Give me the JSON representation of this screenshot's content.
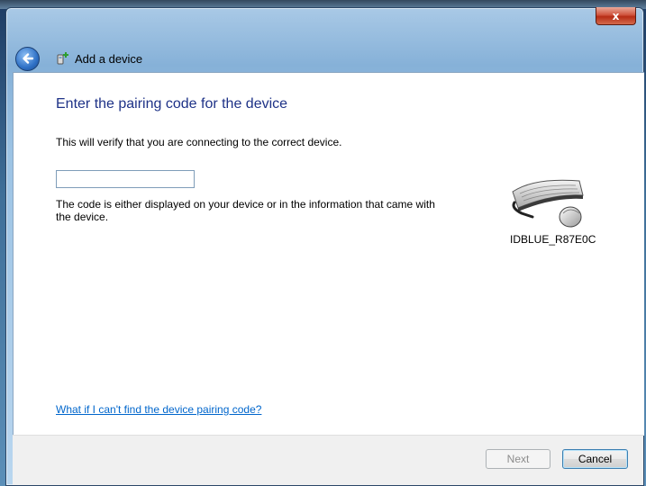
{
  "window": {
    "title": "Add a device",
    "close_label": "x"
  },
  "page": {
    "heading": "Enter the pairing code for the device",
    "description": "This will verify that you are connecting to the correct device.",
    "code_input_value": "",
    "hint": "The code is either displayed on your device or in the information that came with the device.",
    "device_name": "IDBLUE_R87E0C",
    "help_link": "What if I can't find the device pairing code?"
  },
  "buttons": {
    "next_label": "Next",
    "cancel_label": "Cancel"
  },
  "icons": {
    "back": "back-arrow-icon",
    "wizard": "add-device-icon",
    "device": "keyboard-mouse-icon"
  },
  "colors": {
    "heading": "#1e3287",
    "link": "#0066cc",
    "close_button": "#c8462e"
  }
}
